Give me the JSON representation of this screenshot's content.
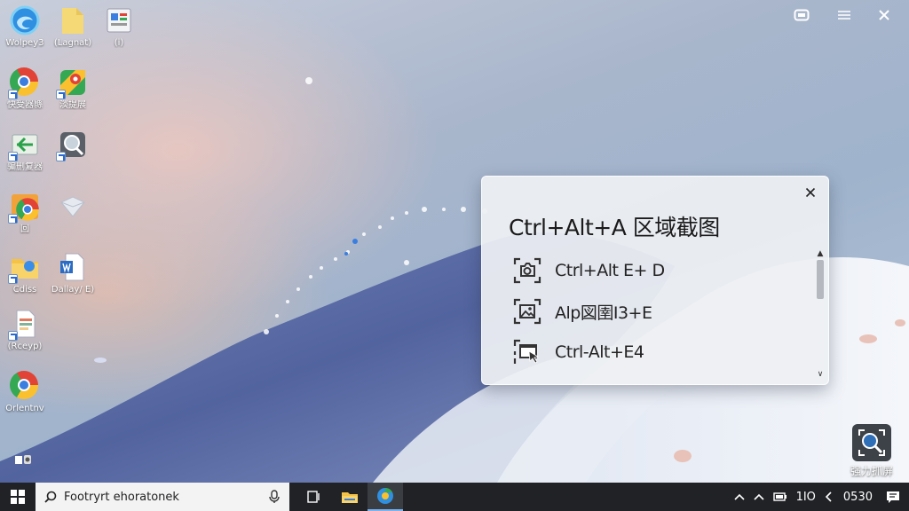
{
  "desktop_icons": [
    {
      "label": "Wolpey3"
    },
    {
      "label": "(Lagnat)"
    },
    {
      "label": "(i)"
    },
    {
      "label": "快受器縣"
    },
    {
      "label": "淡提展"
    },
    {
      "label": "骗删复器"
    },
    {
      "label": ""
    },
    {
      "label": "回"
    },
    {
      "label": ""
    },
    {
      "label": "Cdiss"
    },
    {
      "label": "Dallay/ E)"
    },
    {
      "label": "(Rceyp)"
    },
    {
      "label": "Orlentnv"
    }
  ],
  "popup": {
    "title": "Ctrl+Alt+A 区域截图",
    "items": [
      {
        "label": "Ctrl+Alt E+ D"
      },
      {
        "label": "Alp図圉I3+E"
      },
      {
        "label": "Ctrl-Alt+E4"
      }
    ],
    "scroll_up_glyph": "▲",
    "scroll_down_glyph": "∨"
  },
  "app_tile": {
    "label": "强力抓屏"
  },
  "taskbar": {
    "search_text": "Footryrt ehoratonek",
    "tray_text": "1IO",
    "clock": "0530"
  },
  "colors": {
    "taskbar_bg": "#202226",
    "popup_bg": "#eef0f3",
    "accent": "#7ab3f0"
  }
}
